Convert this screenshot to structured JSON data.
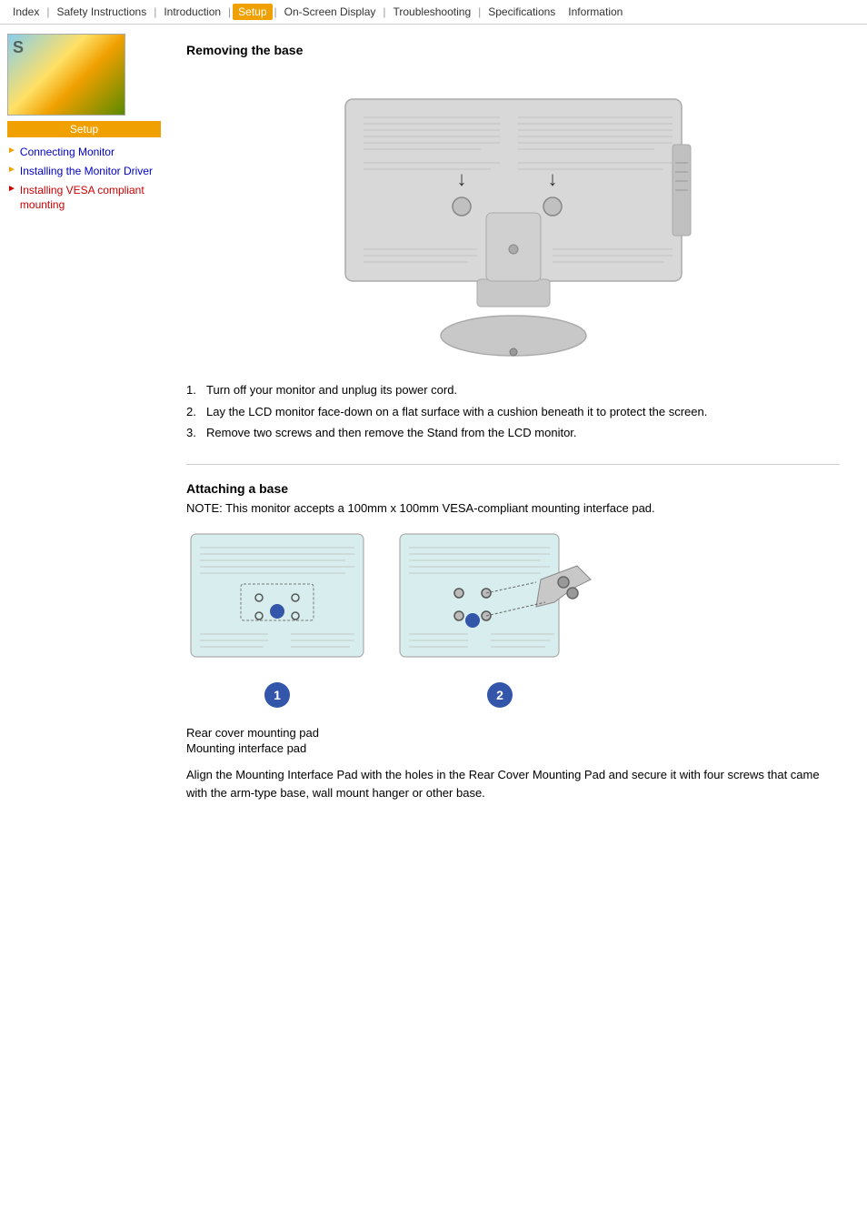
{
  "navbar": {
    "items": [
      {
        "label": "Index",
        "active": false
      },
      {
        "label": "Safety Instructions",
        "active": false
      },
      {
        "label": "Introduction",
        "active": false
      },
      {
        "label": "Setup",
        "active": true
      },
      {
        "label": "On-Screen Display",
        "active": false
      },
      {
        "label": "Troubleshooting",
        "active": false
      },
      {
        "label": "Specifications",
        "active": false
      },
      {
        "label": "Information",
        "active": false
      }
    ]
  },
  "sidebar": {
    "setup_label": "Setup",
    "links": [
      {
        "label": "Connecting Monitor",
        "active": false
      },
      {
        "label": "Installing the Monitor Driver",
        "active": false
      },
      {
        "label": "Installing VESA compliant mounting",
        "active": true
      }
    ]
  },
  "content": {
    "removing_base_title": "Removing the base",
    "steps_removing": [
      "Turn off your monitor and unplug its power cord.",
      "Lay the LCD monitor face-down on a flat surface with a cushion beneath it to protect the screen.",
      "Remove two screws and then remove the Stand from the LCD monitor."
    ],
    "attaching_title": "Attaching a base",
    "attaching_note": "NOTE: This monitor accepts a 100mm x 100mm VESA-compliant mounting interface pad.",
    "legend": [
      "Rear cover mounting pad",
      "Mounting interface pad"
    ],
    "final_note": "Align the Mounting Interface Pad with the holes in the Rear Cover Mounting Pad and secure it with four screws that came with the arm-type base, wall mount hanger or other base."
  }
}
